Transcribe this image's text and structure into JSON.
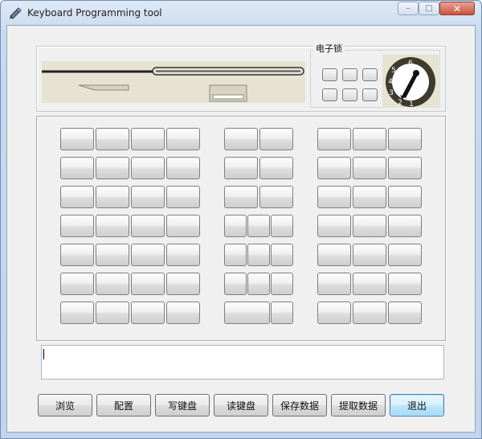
{
  "window": {
    "title": "Keyboard Programming tool"
  },
  "controls": {
    "minimize": "–",
    "maximize": "□",
    "close": "✕"
  },
  "ekey": {
    "label": "电子锁",
    "dial_numbers": [
      "6",
      "5",
      "4",
      "3",
      "2",
      "1"
    ]
  },
  "output": {
    "value": ""
  },
  "buttons": {
    "browse": "浏览",
    "config": "配置",
    "write_keyboard": "写键盘",
    "read_keyboard": "读键盘",
    "save_data": "保存数据",
    "extract_data": "提取数据",
    "exit": "退出"
  },
  "icons": {
    "app": "keyboard-pen-icon",
    "card-slot": "card-reader-icon",
    "lock": "key-lock-icon"
  }
}
